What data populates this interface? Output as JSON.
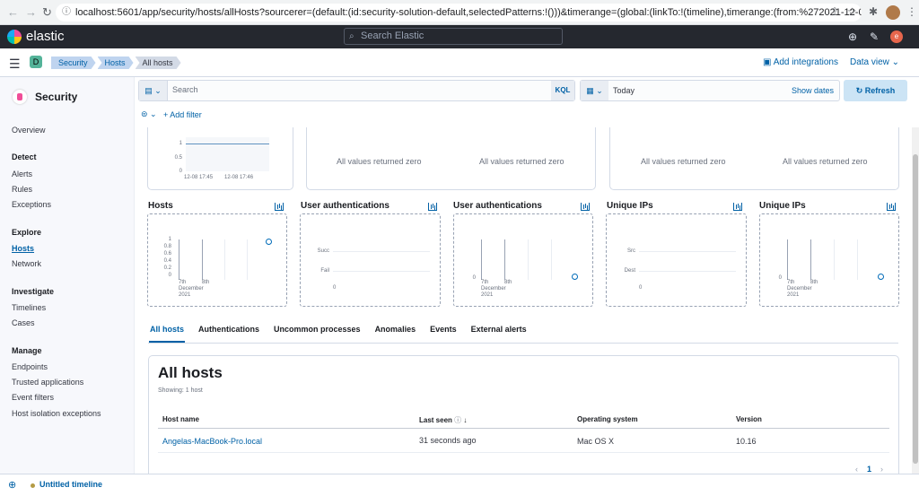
{
  "browser": {
    "url": "localhost:5601/app/security/hosts/allHosts?sourcerer=(default:(id:security-solution-default,selectedPatterns:!()))&timerange=(global:(linkTo:!(timeline),timerange:(from:%272021-12-08T00:00:00.000Z%2..."
  },
  "header": {
    "brand": "elastic",
    "search_placeholder": "Search Elastic",
    "user_initial": "e"
  },
  "subbar": {
    "space_letter": "D",
    "breadcrumbs": [
      "Security",
      "Hosts",
      "All hosts"
    ],
    "add_integrations": "Add integrations",
    "data_view": "Data view"
  },
  "sidebar": {
    "title": "Security",
    "overview": "Overview",
    "groups": [
      {
        "label": "Detect",
        "items": [
          "Alerts",
          "Rules",
          "Exceptions"
        ]
      },
      {
        "label": "Explore",
        "items": [
          "Hosts",
          "Network"
        ]
      },
      {
        "label": "Investigate",
        "items": [
          "Timelines",
          "Cases"
        ]
      },
      {
        "label": "Manage",
        "items": [
          "Endpoints",
          "Trusted applications",
          "Event filters",
          "Host isolation exceptions"
        ]
      }
    ]
  },
  "query": {
    "placeholder": "Search",
    "kql": "KQL",
    "date": "Today",
    "show_dates": "Show dates",
    "refresh": "Refresh",
    "add_filter": "+ Add filter"
  },
  "top_chart": {
    "ticks_y": [
      "1",
      "0.5",
      "0"
    ],
    "ticks_x": [
      "12-08 17:45",
      "12-08 17:46"
    ]
  },
  "zero_msg": "All values returned zero",
  "kpis": [
    {
      "title": "Hosts",
      "y": [
        "1",
        "0.8",
        "0.6",
        "0.4",
        "0.2",
        "0"
      ],
      "x": [
        "7th",
        "8th"
      ],
      "xsub": "December",
      "xyear": "2021"
    },
    {
      "title": "User authentications",
      "y": [
        "Succ",
        "Fail"
      ],
      "zero": "0"
    },
    {
      "title": "User authentications",
      "y": [
        "0"
      ],
      "x": [
        "7th",
        "8th"
      ],
      "xsub": "December",
      "xyear": "2021"
    },
    {
      "title": "Unique IPs",
      "y": [
        "Src",
        "Dest"
      ],
      "zero": "0"
    },
    {
      "title": "Unique IPs",
      "y": [
        "0"
      ],
      "x": [
        "7th",
        "8th"
      ],
      "xsub": "December",
      "xyear": "2021"
    }
  ],
  "tabs": [
    "All hosts",
    "Authentications",
    "Uncommon processes",
    "Anomalies",
    "Events",
    "External alerts"
  ],
  "table": {
    "title": "All hosts",
    "count": "Showing: 1 host",
    "columns": [
      "Host name",
      "Last seen",
      "Operating system",
      "Version"
    ],
    "rows": [
      {
        "host": "Angelas-MacBook-Pro.local",
        "last_seen": "31 seconds ago",
        "os": "Mac OS X",
        "version": "10.16"
      }
    ],
    "page": "1"
  },
  "timeline": {
    "label": "Untitled timeline"
  }
}
